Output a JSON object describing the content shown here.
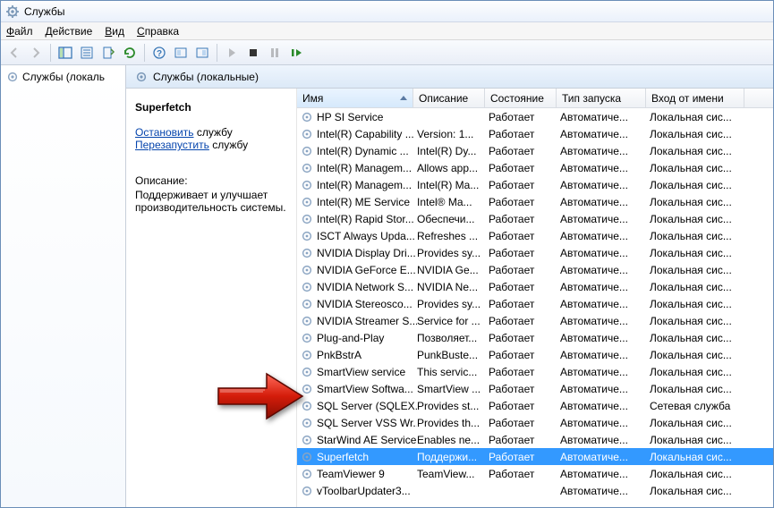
{
  "window": {
    "title": "Службы"
  },
  "menu": {
    "file": "Файл",
    "action": "Действие",
    "view": "Вид",
    "help": "Справка"
  },
  "tree": {
    "root": "Службы (локаль"
  },
  "heading": "Службы (локальные)",
  "details": {
    "name": "Superfetch",
    "stop_link": "Остановить",
    "stop_suffix": " службу",
    "restart_link": "Перезапустить",
    "restart_suffix": " службу",
    "desc_label": "Описание:",
    "desc_text": "Поддерживает и улучшает производительность системы."
  },
  "columns": {
    "name": "Имя",
    "desc": "Описание",
    "state": "Состояние",
    "start": "Тип запуска",
    "user": "Вход от имени"
  },
  "rows": [
    {
      "n": "HP SI Service",
      "d": "",
      "s": "Работает",
      "t": "Автоматиче...",
      "u": "Локальная сис..."
    },
    {
      "n": "Intel(R) Capability ...",
      "d": "Version: 1...",
      "s": "Работает",
      "t": "Автоматиче...",
      "u": "Локальная сис..."
    },
    {
      "n": "Intel(R) Dynamic ...",
      "d": "Intel(R) Dy...",
      "s": "Работает",
      "t": "Автоматиче...",
      "u": "Локальная сис..."
    },
    {
      "n": "Intel(R) Managem...",
      "d": "Allows app...",
      "s": "Работает",
      "t": "Автоматиче...",
      "u": "Локальная сис..."
    },
    {
      "n": "Intel(R) Managem...",
      "d": "Intel(R) Ma...",
      "s": "Работает",
      "t": "Автоматиче...",
      "u": "Локальная сис..."
    },
    {
      "n": "Intel(R) ME Service",
      "d": "Intel® Ma...",
      "s": "Работает",
      "t": "Автоматиче...",
      "u": "Локальная сис..."
    },
    {
      "n": "Intel(R) Rapid Stor...",
      "d": "Обеспечи...",
      "s": "Работает",
      "t": "Автоматиче...",
      "u": "Локальная сис..."
    },
    {
      "n": "ISCT Always Upda...",
      "d": "Refreshes ...",
      "s": "Работает",
      "t": "Автоматиче...",
      "u": "Локальная сис..."
    },
    {
      "n": "NVIDIA Display Dri...",
      "d": "Provides sy...",
      "s": "Работает",
      "t": "Автоматиче...",
      "u": "Локальная сис..."
    },
    {
      "n": "NVIDIA GeForce E...",
      "d": "NVIDIA Ge...",
      "s": "Работает",
      "t": "Автоматиче...",
      "u": "Локальная сис..."
    },
    {
      "n": "NVIDIA Network S...",
      "d": "NVIDIA Ne...",
      "s": "Работает",
      "t": "Автоматиче...",
      "u": "Локальная сис..."
    },
    {
      "n": "NVIDIA Stereosco...",
      "d": "Provides sy...",
      "s": "Работает",
      "t": "Автоматиче...",
      "u": "Локальная сис..."
    },
    {
      "n": "NVIDIA Streamer S...",
      "d": "Service for ...",
      "s": "Работает",
      "t": "Автоматиче...",
      "u": "Локальная сис..."
    },
    {
      "n": "Plug-and-Play",
      "d": "Позволяет...",
      "s": "Работает",
      "t": "Автоматиче...",
      "u": "Локальная сис..."
    },
    {
      "n": "PnkBstrA",
      "d": "PunkBuste...",
      "s": "Работает",
      "t": "Автоматиче...",
      "u": "Локальная сис..."
    },
    {
      "n": "SmartView service",
      "d": "This servic...",
      "s": "Работает",
      "t": "Автоматиче...",
      "u": "Локальная сис..."
    },
    {
      "n": "SmartView Softwa...",
      "d": "SmartView ...",
      "s": "Работает",
      "t": "Автоматиче...",
      "u": "Локальная сис..."
    },
    {
      "n": "SQL Server (SQLEX...",
      "d": "Provides st...",
      "s": "Работает",
      "t": "Автоматиче...",
      "u": "Сетевая служба"
    },
    {
      "n": "SQL Server VSS Wr...",
      "d": "Provides th...",
      "s": "Работает",
      "t": "Автоматиче...",
      "u": "Локальная сис..."
    },
    {
      "n": "StarWind AE Service",
      "d": "Enables ne...",
      "s": "Работает",
      "t": "Автоматиче...",
      "u": "Локальная сис..."
    },
    {
      "n": "Superfetch",
      "d": "Поддержи...",
      "s": "Работает",
      "t": "Автоматиче...",
      "u": "Локальная сис...",
      "sel": true
    },
    {
      "n": "TeamViewer 9",
      "d": "TeamView...",
      "s": "Работает",
      "t": "Автоматиче...",
      "u": "Локальная сис..."
    },
    {
      "n": "vToolbarUpdater3...",
      "d": "",
      "s": "",
      "t": "Автоматиче...",
      "u": "Локальная сис..."
    }
  ]
}
